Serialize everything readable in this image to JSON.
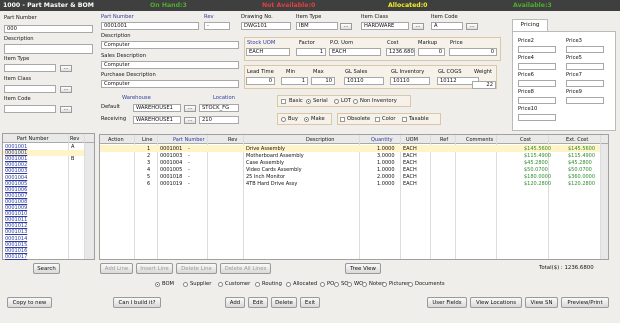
{
  "title": "1000 - Part Master & BOM",
  "on_hand": "On Hand:3",
  "not_available": "Not Available:0",
  "allocated": "Allocated:0",
  "available": "Available:3",
  "left": {
    "part_number_label": "Part Number",
    "part_number": "000",
    "description_label": "Description",
    "item_type_label": "Item Type",
    "item_class_label": "Item Class",
    "item_code_label": "Item Code",
    "list_headers": [
      "Part Number",
      "Rev"
    ],
    "list_rows": [
      {
        "part": "0001001",
        "rev": "A"
      },
      {
        "part": "0001001",
        "rev": ""
      },
      {
        "part": "0001001",
        "rev": "B"
      },
      {
        "part": "0001002",
        "rev": ""
      },
      {
        "part": "0001003",
        "rev": ""
      },
      {
        "part": "0001004",
        "rev": ""
      },
      {
        "part": "0001005",
        "rev": ""
      },
      {
        "part": "0001006",
        "rev": ""
      },
      {
        "part": "0001007",
        "rev": ""
      },
      {
        "part": "0001008",
        "rev": ""
      },
      {
        "part": "0001009",
        "rev": ""
      },
      {
        "part": "0001010",
        "rev": ""
      },
      {
        "part": "0001011",
        "rev": ""
      },
      {
        "part": "0001012",
        "rev": ""
      },
      {
        "part": "0001013",
        "rev": ""
      },
      {
        "part": "0001014",
        "rev": ""
      },
      {
        "part": "0001015",
        "rev": ""
      },
      {
        "part": "0001016",
        "rev": ""
      },
      {
        "part": "0001017",
        "rev": ""
      }
    ],
    "search": "Search"
  },
  "form": {
    "part_number_label": "Part Number",
    "part_number": "0001001",
    "rev_label": "Rev",
    "rev": "-",
    "drawing_label": "Drawing No.",
    "drawing": "DWG101",
    "item_type_label": "Item Type",
    "item_type": "IBM",
    "item_class_label": "Item Class",
    "item_class": "HARDWARE",
    "item_code_label": "Item Code",
    "item_code": "A",
    "description_label": "Description",
    "description": "Computer",
    "sales_desc_label": "Sales Description",
    "sales_desc": "Computer",
    "purchase_desc_label": "Purchase Description",
    "purchase_desc": "Computer",
    "warehouse_label": "Warehouse",
    "location_label": "Location",
    "default_label": "Default",
    "default_wh": "WAREHOUSE1",
    "default_loc": "STOCK_FG",
    "receiving_label": "Receiving",
    "receiving_wh": "WAREHOUSE1",
    "receiving_loc": "210",
    "stock_uom_label": "Stock UOM",
    "stock_uom": "EACH",
    "factor_label": "Factor",
    "factor": "1",
    "po_uom_label": "P.O. Uom",
    "po_uom": "EACH",
    "cost_label": "Cost",
    "cost": "1236.6800",
    "markup_label": "Markup",
    "markup": "0",
    "price_label": "Price",
    "price": "0",
    "lead_time_label": "Lead Time",
    "lead_time": "0",
    "min_label": "Min",
    "min": "1",
    "max_label": "Max",
    "max": "10",
    "gl_sales_label": "GL Sales",
    "gl_sales": "10110",
    "gl_inventory_label": "GL Inventory",
    "gl_inventory": "10110",
    "gl_cogs_label": "GL COGS",
    "gl_cogs": "10112",
    "weight_label": "Weight",
    "weight": "22",
    "basic": "Basic",
    "serial": "Serial",
    "lot": "LOT",
    "non_inventory": "Non Inventory",
    "buy": "Buy",
    "make": "Make",
    "obsolete": "Obsolete",
    "color": "Color",
    "taxable": "Taxable"
  },
  "pricing": {
    "tab": "Pricing",
    "labels": [
      "Price2",
      "Price3",
      "Price4",
      "Price5",
      "Price6",
      "Price7",
      "Price8",
      "Price9",
      "Price10"
    ]
  },
  "bom": {
    "headers": [
      "Action",
      "Line",
      "Part Number",
      "Rev",
      "Description",
      "Quantity",
      "UOM",
      "Ref",
      "Comments",
      "Cost",
      "Ext. Cost"
    ],
    "rows": [
      {
        "line": "1",
        "part": "0001001",
        "rev": "-",
        "desc": "Drive Assembly",
        "qty": "1.0000",
        "uom": "EACH",
        "cost": "$145.5600",
        "ext": "$145.5600"
      },
      {
        "line": "2",
        "part": "0001003",
        "rev": "-",
        "desc": "Motherboard Assembly",
        "qty": "3.0000",
        "uom": "EACH",
        "cost": "$115.4900",
        "ext": "$115.4900"
      },
      {
        "line": "3",
        "part": "0001004",
        "rev": "-",
        "desc": "Case Assembly",
        "qty": "1.0000",
        "uom": "EACH",
        "cost": "$45.2800",
        "ext": "$45.2800"
      },
      {
        "line": "4",
        "part": "0001005",
        "rev": "-",
        "desc": "Video Cards Assembly",
        "qty": "1.0000",
        "uom": "EACH",
        "cost": "$50.0700",
        "ext": "$50.0700"
      },
      {
        "line": "5",
        "part": "0001018",
        "rev": "-",
        "desc": "25 Inch Monitor",
        "qty": "2.0000",
        "uom": "EACH",
        "cost": "$180.0000",
        "ext": "$360.0000"
      },
      {
        "line": "6",
        "part": "0001019",
        "rev": "-",
        "desc": "4TB Hard Drive Assy",
        "qty": "1.0000",
        "uom": "EACH",
        "cost": "$120.2800",
        "ext": "$120.2800"
      }
    ],
    "add_line": "Add Line",
    "insert_line": "Insert Line",
    "delete_line": "Delete Line",
    "delete_all": "Delete All Lines",
    "tree_view": "Tree View",
    "total": "Total($) : 1236.6800"
  },
  "radios": [
    "BOM",
    "Supplier",
    "Customer",
    "Routing",
    "Allocated",
    "PO",
    "SO",
    "WO",
    "Notes",
    "Pictures",
    "Documents"
  ],
  "footer": {
    "copy_to_new": "Copy to new",
    "can_i_build": "Can I build it?",
    "add": "Add",
    "edit": "Edit",
    "delete": "Delete",
    "exit": "Exit",
    "user_fields": "User Fields",
    "view_locations": "View Locations",
    "view_sn": "View SN",
    "preview_print": "Preview/Print"
  },
  "colors": {
    "title_bg": "#3f3f3f",
    "title_text": "#ffffff",
    "status_green": "#4caf2e",
    "status_red": "#e04040",
    "status_yellow": "#f0f020",
    "link": "#2c3b9e",
    "cost_green": "#2e8b2e"
  }
}
